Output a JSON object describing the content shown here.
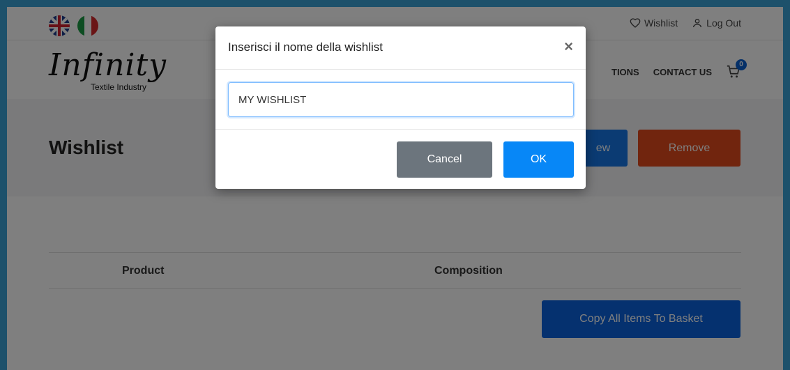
{
  "topbar": {
    "wishlist_label": "Wishlist",
    "logout_label": "Log Out"
  },
  "logo": {
    "main": "Infinity",
    "sub": "Textile Industry"
  },
  "nav": {
    "items": [
      "TIONS",
      "CONTACT US"
    ],
    "cart_count": "0"
  },
  "page": {
    "title": "Wishlist",
    "new_button": "ew",
    "remove_button": "Remove",
    "table_headers": [
      "Product",
      "Composition"
    ],
    "copy_button": "Copy All Items To Basket"
  },
  "modal": {
    "title": "Inserisci il nome della wishlist",
    "close": "×",
    "input_value": "MY WISHLIST",
    "cancel_label": "Cancel",
    "ok_label": "OK"
  },
  "colors": {
    "primary": "#0787f7",
    "danger": "#e24a1c",
    "secondary": "#6c757d",
    "background": "#3aa3d6"
  }
}
